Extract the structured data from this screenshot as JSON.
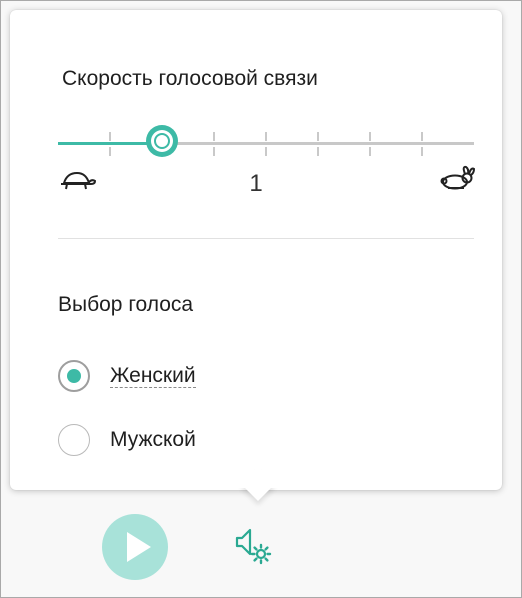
{
  "colors": {
    "accent": "#3dbaa6",
    "play_button_bg": "#a8e2d9",
    "track": "#c8c8c8"
  },
  "voice_speed": {
    "title": "Скорость голосовой связи",
    "value_label": "1",
    "slider_fraction": 0.25,
    "tick_count": 8,
    "slow_icon": "turtle-icon",
    "fast_icon": "rabbit-icon"
  },
  "voice_selection": {
    "title": "Выбор голоса",
    "options": [
      {
        "label": "Женский",
        "checked": true
      },
      {
        "label": "Мужской",
        "checked": false
      }
    ]
  },
  "toolbar": {
    "play_icon": "play-icon",
    "voice_settings_icon": "speaker-settings-icon"
  }
}
